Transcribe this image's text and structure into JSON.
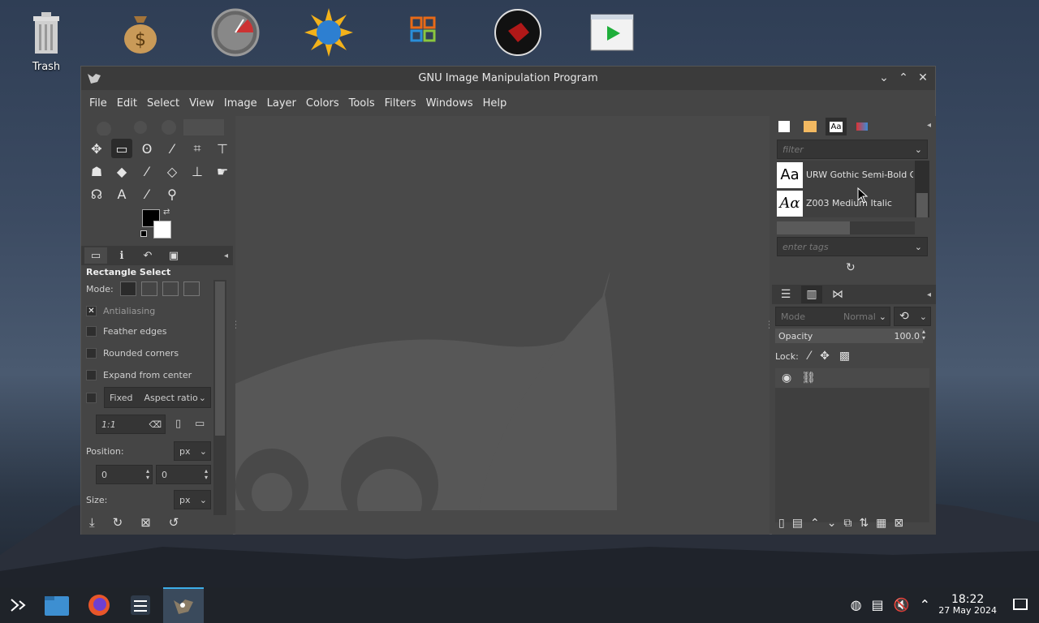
{
  "desktop": {
    "icons": [
      {
        "name": "trash-icon",
        "label": "Trash"
      },
      {
        "name": "money-bag-icon",
        "label": ""
      },
      {
        "name": "speedometer-icon",
        "label": ""
      },
      {
        "name": "globe-sun-icon",
        "label": ""
      },
      {
        "name": "office-icon",
        "label": ""
      },
      {
        "name": "red-dot-icon",
        "label": ""
      },
      {
        "name": "play-icon",
        "label": ""
      }
    ]
  },
  "window": {
    "title": "GNU Image Manipulation Program",
    "controls": {
      "minimize": "⌄",
      "maximize": "⌃",
      "close": "✕"
    }
  },
  "menubar": {
    "items": [
      "File",
      "Edit",
      "Select",
      "View",
      "Image",
      "Layer",
      "Colors",
      "Tools",
      "Filters",
      "Windows",
      "Help"
    ]
  },
  "toolbox": {
    "tools": [
      "✥",
      "▭",
      "⊙",
      "✎",
      "⌗",
      "T"
    ]
  },
  "tool_options": {
    "title": "Rectangle Select",
    "mode_label": "Mode:",
    "antialiasing": "Antialiasing",
    "feather_edges": "Feather edges",
    "rounded_corners": "Rounded corners",
    "expand_from_center": "Expand from center",
    "fixed_label": "Fixed",
    "fixed_option": "Aspect ratio",
    "ratio_value": "1:1",
    "position_label": "Position:",
    "position_unit": "px",
    "position_x": "0",
    "position_y": "0",
    "size_label": "Size:",
    "size_unit": "px"
  },
  "fonts_panel": {
    "filter_placeholder": "filter",
    "fonts": [
      {
        "preview": "Aa",
        "name": "URW Gothic Semi-Bold Oblique"
      },
      {
        "preview": "Aα",
        "name": "Z003 Medium Italic"
      }
    ],
    "tags_placeholder": "enter tags"
  },
  "layers_panel": {
    "mode_label": "Mode",
    "mode_value": "Normal",
    "opacity_label": "Opacity",
    "opacity_value": "100.0",
    "lock_label": "Lock:"
  },
  "taskbar": {
    "time": "18:22",
    "date": "27 May 2024"
  },
  "colors": {
    "accent": "#3daee9"
  }
}
